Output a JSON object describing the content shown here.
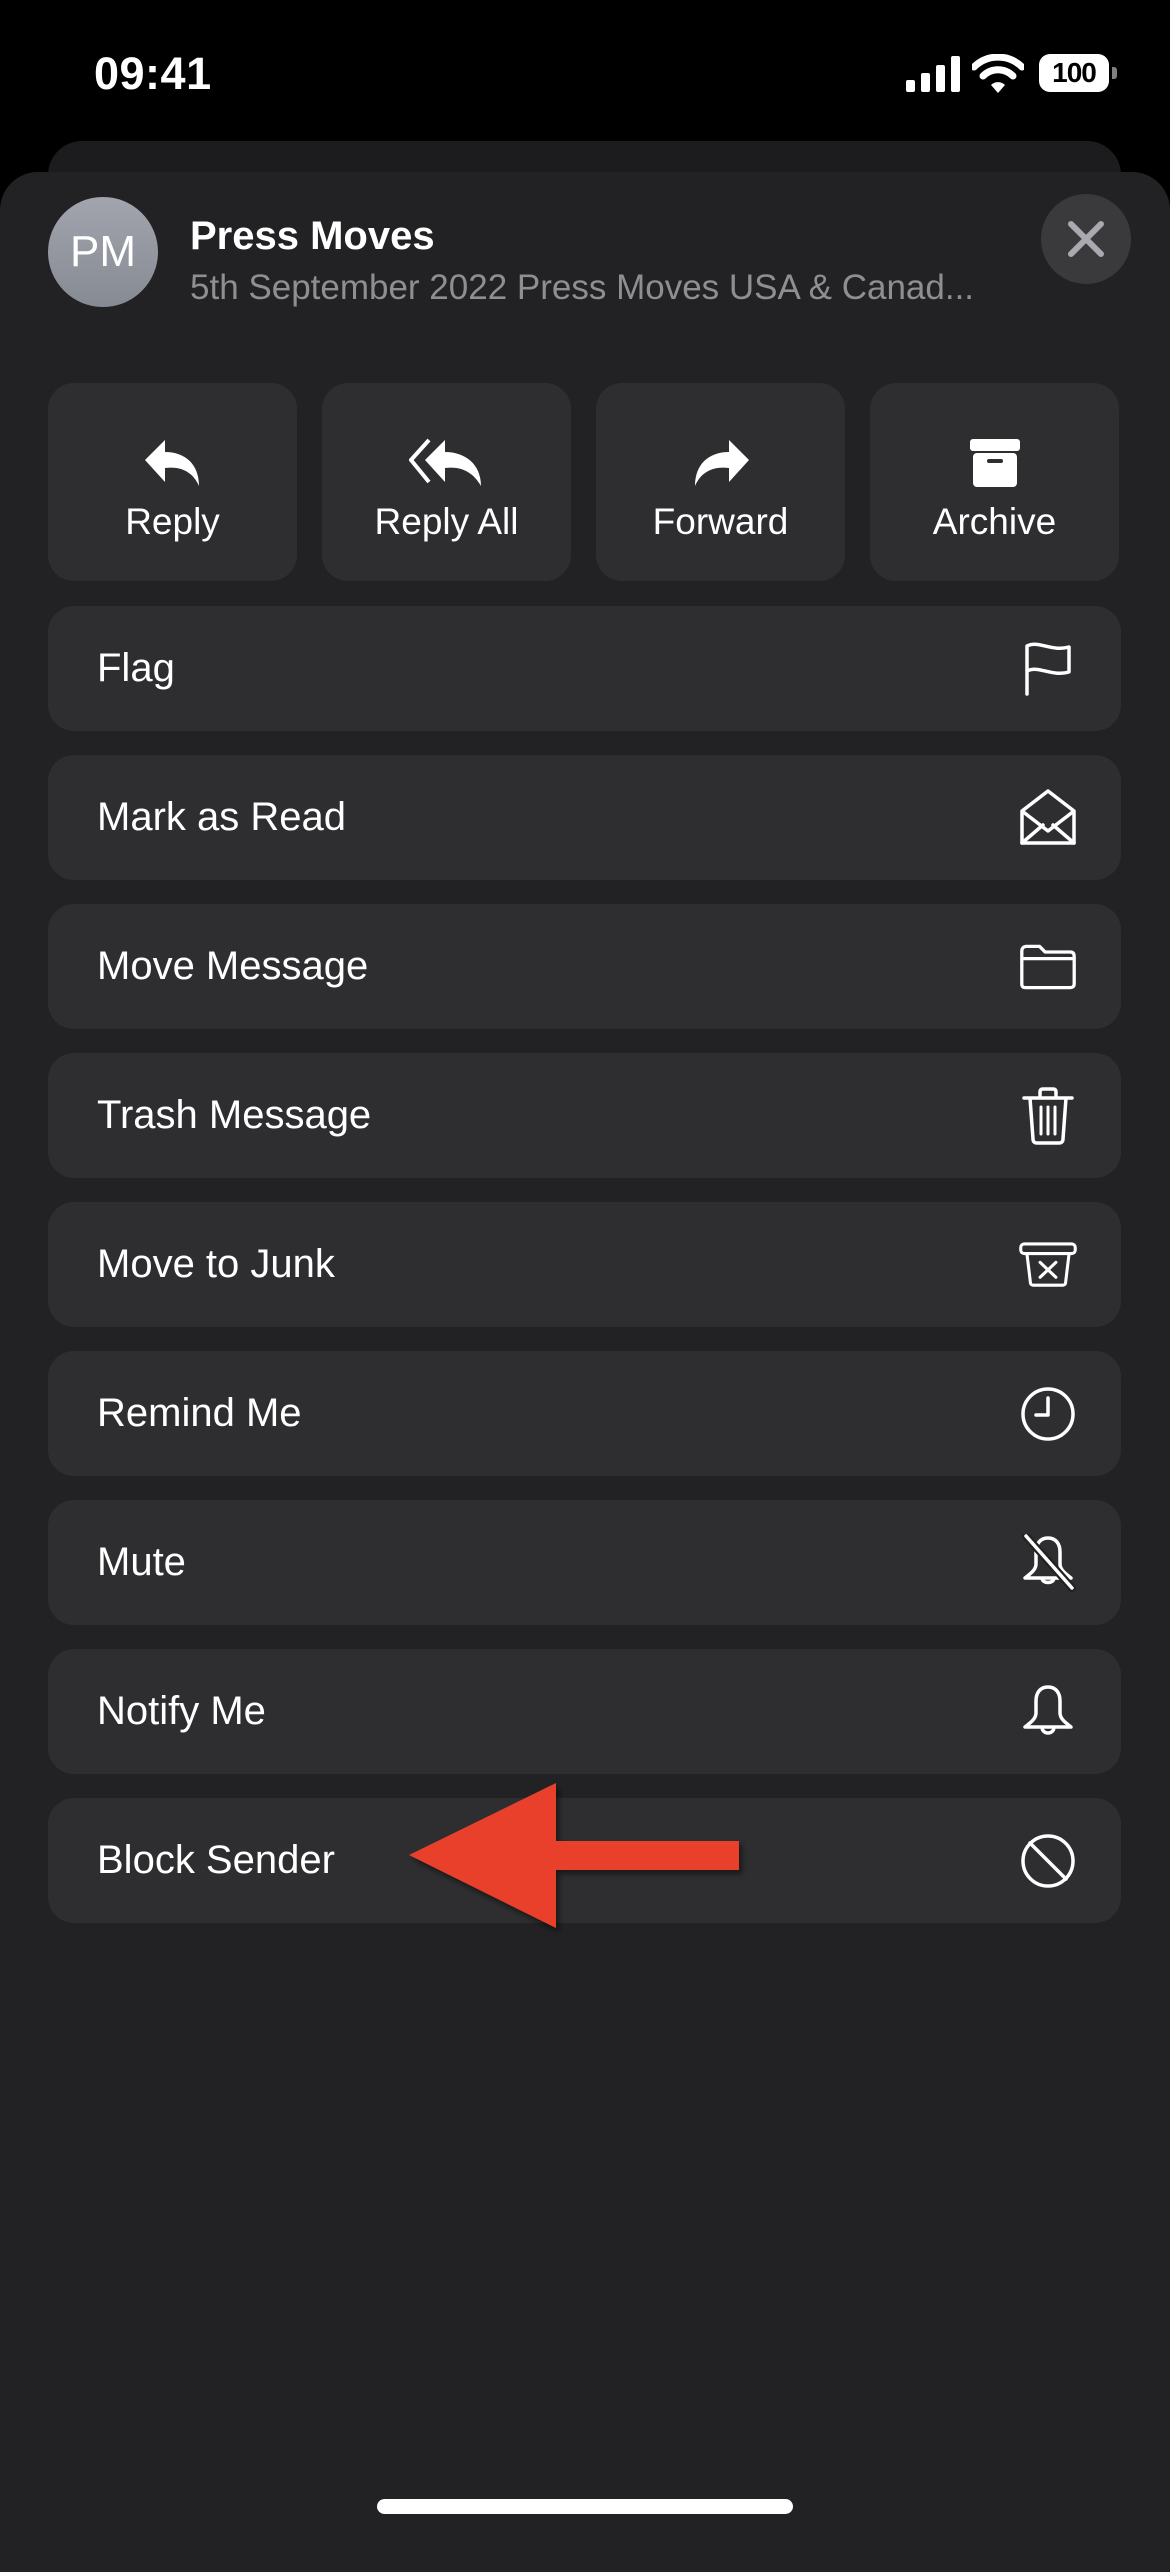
{
  "status_bar": {
    "time": "09:41",
    "battery_level": "100",
    "icons": [
      "signal-icon",
      "wifi-icon",
      "battery-icon"
    ]
  },
  "header": {
    "avatar_initials": "PM",
    "sender": "Press Moves",
    "subject": "5th September 2022 Press Moves USA & Canad...",
    "close_icon": "close-icon"
  },
  "quick_actions": [
    {
      "label": "Reply",
      "icon": "reply-icon"
    },
    {
      "label": "Reply All",
      "icon": "reply-all-icon"
    },
    {
      "label": "Forward",
      "icon": "forward-icon"
    },
    {
      "label": "Archive",
      "icon": "archive-icon"
    }
  ],
  "actions": [
    {
      "label": "Flag",
      "icon": "flag-icon"
    },
    {
      "label": "Mark as Read",
      "icon": "envelope-open-icon"
    },
    {
      "label": "Move Message",
      "icon": "folder-icon"
    },
    {
      "label": "Trash Message",
      "icon": "trash-icon"
    },
    {
      "label": "Move to Junk",
      "icon": "junk-bin-icon"
    },
    {
      "label": "Remind Me",
      "icon": "clock-icon"
    },
    {
      "label": "Mute",
      "icon": "bell-slash-icon"
    },
    {
      "label": "Notify Me",
      "icon": "bell-icon"
    },
    {
      "label": "Block Sender",
      "icon": "block-icon"
    }
  ],
  "annotation": {
    "type": "arrow",
    "points_to": "Block Sender",
    "color": "#E8402A"
  },
  "colors": {
    "sheet_background": "#222224",
    "row_background": "#2E2E30",
    "secondary_text": "#8E8E93"
  }
}
